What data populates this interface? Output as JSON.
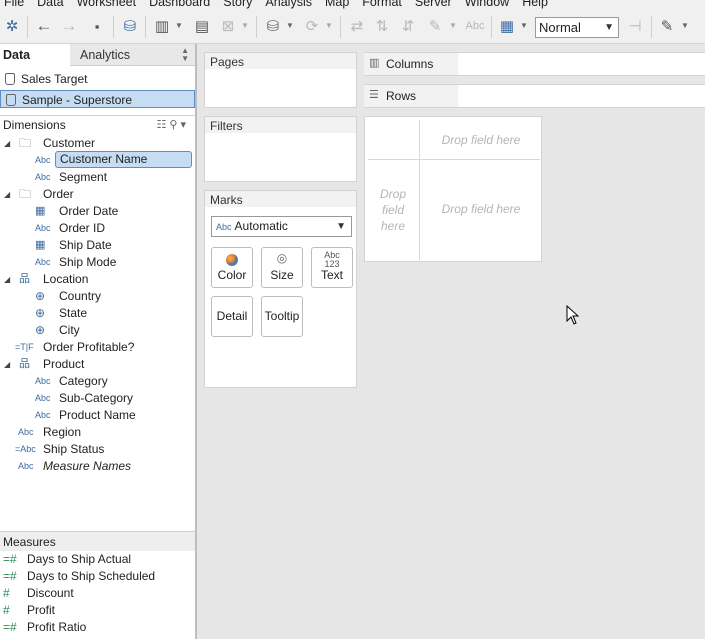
{
  "menu": [
    "File",
    "Data",
    "Worksheet",
    "Dashboard",
    "Story",
    "Analysis",
    "Map",
    "Format",
    "Server",
    "Window",
    "Help"
  ],
  "toolbar": {
    "fit_value": "Normal",
    "icons": [
      "tableau-logo-icon",
      "undo-icon",
      "redo-icon",
      "save-icon",
      "new-datasource-icon",
      "new-worksheet-icon",
      "duplicate-icon",
      "clear-icon",
      "pause-updates-icon",
      "refresh-icon",
      "swap-icon",
      "sort-ascending-icon",
      "sort-descending-icon",
      "highlight-icon",
      "labels-icon",
      "show-me-icon",
      "fit-select",
      "pin-icon",
      "pen-icon"
    ]
  },
  "leftpane": {
    "tab_data": "Data",
    "tab_analytics": "Analytics",
    "datasources": [
      {
        "label": "Sales Target",
        "selected": false
      },
      {
        "label": "Sample - Superstore",
        "selected": true
      }
    ],
    "dimensions_title": "Dimensions",
    "dimensions": [
      {
        "label": "Customer",
        "type": "folder",
        "indent": 0,
        "expanded": true
      },
      {
        "label": "Customer Name",
        "type": "abc",
        "indent": 1,
        "selected": true
      },
      {
        "label": "Segment",
        "type": "abc",
        "indent": 1
      },
      {
        "label": "Order",
        "type": "folder",
        "indent": 0,
        "expanded": true
      },
      {
        "label": "Order Date",
        "type": "date",
        "indent": 1
      },
      {
        "label": "Order ID",
        "type": "abc",
        "indent": 1
      },
      {
        "label": "Ship Date",
        "type": "date",
        "indent": 1
      },
      {
        "label": "Ship Mode",
        "type": "abc",
        "indent": 1
      },
      {
        "label": "Location",
        "type": "hierarchy",
        "indent": 0,
        "expanded": true
      },
      {
        "label": "Country",
        "type": "geo",
        "indent": 1
      },
      {
        "label": "State",
        "type": "geo",
        "indent": 1
      },
      {
        "label": "City",
        "type": "geo",
        "indent": 1
      },
      {
        "label": "Order Profitable?",
        "type": "bool",
        "indent": 0
      },
      {
        "label": "Product",
        "type": "hierarchy",
        "indent": 0,
        "expanded": true
      },
      {
        "label": "Category",
        "type": "abc",
        "indent": 1
      },
      {
        "label": "Sub-Category",
        "type": "abc",
        "indent": 1
      },
      {
        "label": "Product Name",
        "type": "abc",
        "indent": 1
      },
      {
        "label": "Region",
        "type": "abc",
        "indent": 0
      },
      {
        "label": "Ship Status",
        "type": "calc-abc",
        "indent": 0
      },
      {
        "label": "Measure Names",
        "type": "abc",
        "indent": 0,
        "italic": true
      }
    ],
    "measures_title": "Measures",
    "measures": [
      {
        "label": "Days to Ship Actual",
        "type": "calc-num"
      },
      {
        "label": "Days to Ship Scheduled",
        "type": "calc-num"
      },
      {
        "label": "Discount",
        "type": "num"
      },
      {
        "label": "Profit",
        "type": "num"
      },
      {
        "label": "Profit Ratio",
        "type": "calc-num"
      }
    ]
  },
  "cards": {
    "pages": "Pages",
    "filters": "Filters",
    "marks": "Marks",
    "marks_type": "Automatic",
    "mark_buttons": [
      "Color",
      "Size",
      "Text",
      "Detail",
      "Tooltip"
    ]
  },
  "shelves": {
    "columns": "Columns",
    "rows": "Rows"
  },
  "view": {
    "drop_top": "Drop field here",
    "drop_left": "Drop field here",
    "drop_center": "Drop field here"
  }
}
